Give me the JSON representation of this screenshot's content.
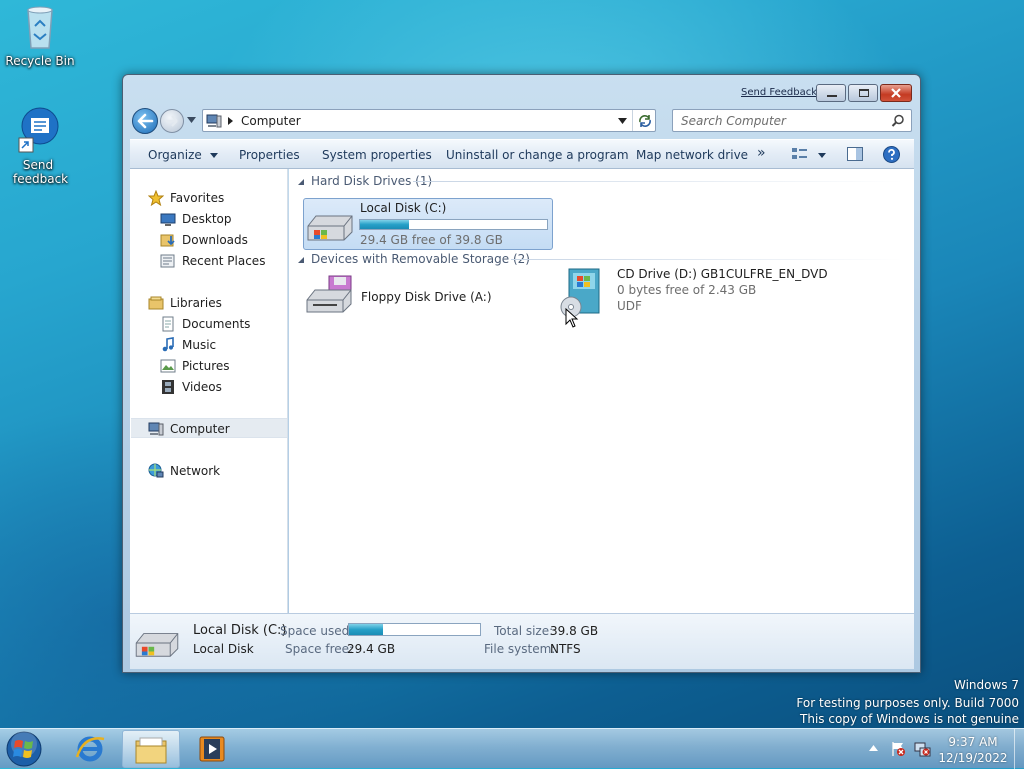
{
  "desktop": {
    "icons": [
      {
        "label": "Recycle Bin",
        "icon": "recycle-bin-icon"
      },
      {
        "label": "Send feedback",
        "icon": "send-feedback-icon"
      }
    ]
  },
  "window": {
    "feedback_link": "Send Feedback",
    "address": {
      "location": "Computer"
    },
    "search": {
      "placeholder": "Search Computer"
    },
    "toolbar": {
      "organize": "Organize",
      "properties": "Properties",
      "system_properties": "System properties",
      "uninstall": "Uninstall or change a program",
      "map_drive": "Map network drive",
      "more": "»"
    },
    "nav": {
      "favorites": "Favorites",
      "desktop": "Desktop",
      "downloads": "Downloads",
      "recent_places": "Recent Places",
      "libraries": "Libraries",
      "documents": "Documents",
      "music": "Music",
      "pictures": "Pictures",
      "videos": "Videos",
      "computer": "Computer",
      "network": "Network"
    },
    "groups": {
      "hard_disks": "Hard Disk Drives (1)",
      "removable": "Devices with Removable Storage (2)"
    },
    "drives": {
      "local_c": {
        "name": "Local Disk (C:)",
        "free_text": "29.4 GB free of 39.8 GB",
        "used_fraction": 0.26
      },
      "floppy": {
        "name": "Floppy Disk Drive (A:)"
      },
      "cd": {
        "name": "CD Drive (D:) GB1CULFRE_EN_DVD",
        "free_text": "0 bytes free of 2.43 GB",
        "fs": "UDF"
      }
    },
    "details": {
      "title": "Local Disk (C:)",
      "subtitle": "Local Disk",
      "space_used_label": "Space used:",
      "space_free_label": "Space free:",
      "space_free_value": "29.4 GB",
      "total_label": "Total size:",
      "total_value": "39.8 GB",
      "fs_label": "File system:",
      "fs_value": "NTFS",
      "used_fraction": 0.26
    }
  },
  "watermark": {
    "line1": "Windows  7",
    "line2": "For testing purposes only. Build 7000",
    "line3": "This copy of Windows is not genuine"
  },
  "taskbar": {
    "time": "9:37 AM",
    "date": "12/19/2022"
  },
  "colors": {
    "accent": "#26a0c8",
    "selection": "#c4dcf4"
  }
}
